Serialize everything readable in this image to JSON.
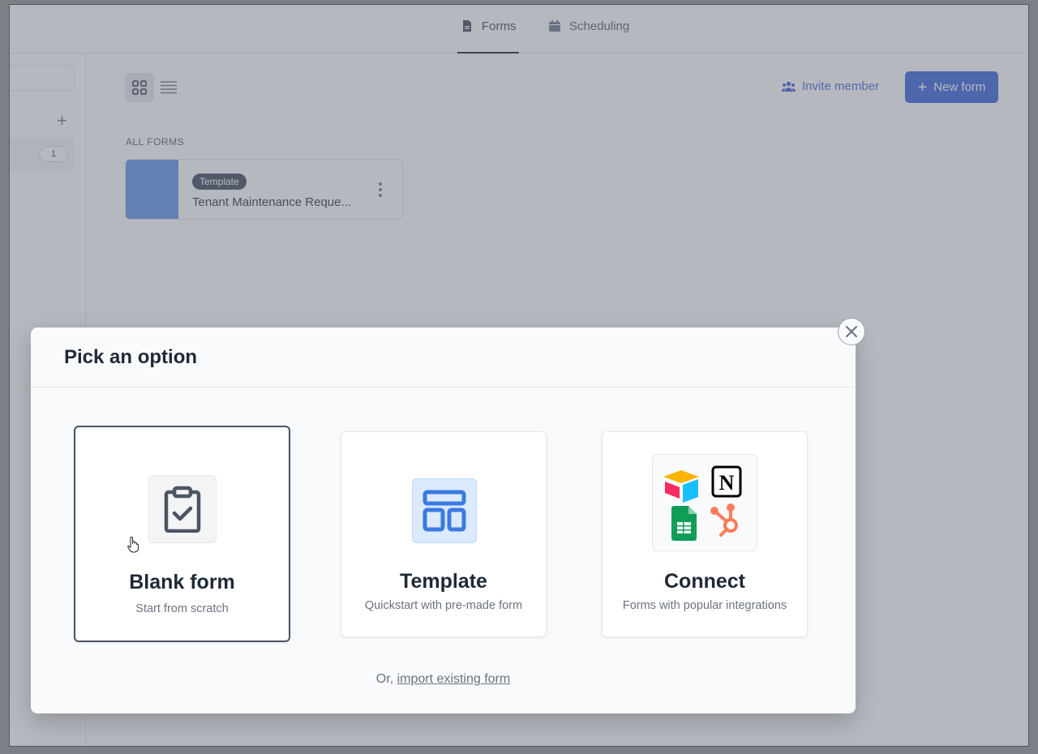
{
  "topbar": {
    "tabs": [
      {
        "label": "Forms",
        "icon": "document-icon",
        "active": true
      },
      {
        "label": "Scheduling",
        "icon": "calendar-icon",
        "active": false
      }
    ]
  },
  "sidebar": {
    "count": "1"
  },
  "toolbar": {
    "invite_label": "Invite member",
    "new_form_label": "New form"
  },
  "forms": {
    "section_label": "ALL FORMS",
    "items": [
      {
        "badge": "Template",
        "name": "Tenant Maintenance Reque...",
        "thumb_color": "#5b8fe6"
      }
    ]
  },
  "modal": {
    "title": "Pick an option",
    "options": [
      {
        "title": "Blank form",
        "subtitle": "Start from scratch",
        "icon": "clipboard-check-icon",
        "selected": true
      },
      {
        "title": "Template",
        "subtitle": "Quickstart with pre-made form",
        "icon": "layout-icon",
        "selected": false
      },
      {
        "title": "Connect",
        "subtitle": "Forms with popular integrations",
        "icon": "integrations-icon",
        "selected": false
      }
    ],
    "import_prefix": "Or,",
    "import_link": "import existing form"
  },
  "colors": {
    "primary": "#2f5bd8",
    "overlay": "rgba(107,114,128,0.5)"
  }
}
